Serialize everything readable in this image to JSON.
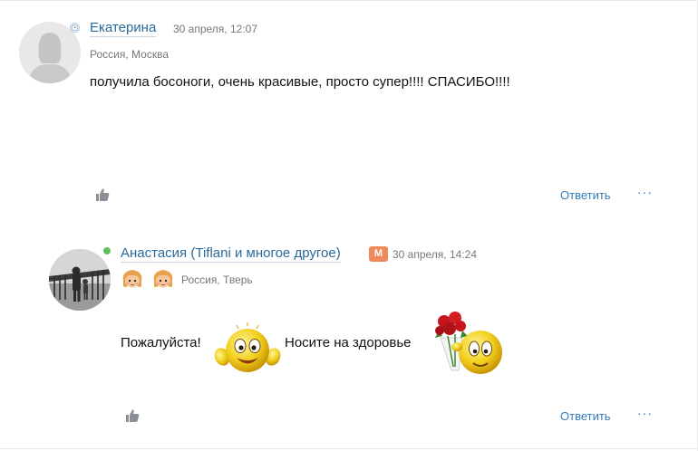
{
  "comments": [
    {
      "author": "Екатерина",
      "date": "30 апреля, 12:07",
      "location": "Россия, Москва",
      "text": "получила босоноги, очень красивые, просто супер!!!! СПАСИБО!!!!",
      "reply_label": "Ответить",
      "more_label": "···",
      "avatar_icon": "default-avatar-icon",
      "status_icon": "clock-icon"
    },
    {
      "author": "Анастасия (Tiflani и многое другое)",
      "badge": "М",
      "badge_color": "#f08a5d",
      "date": "30 апреля, 14:24",
      "location": "Россия, Тверь",
      "text_part1": "Пожалуйста!",
      "text_part2": "Носите на здоровье",
      "reply_label": "Ответить",
      "more_label": "···",
      "online_color": "#5cc15c"
    }
  ],
  "colors": {
    "author_link": "#2a6a9c",
    "action_link": "#2f7bbd",
    "meta_text": "#777777"
  }
}
